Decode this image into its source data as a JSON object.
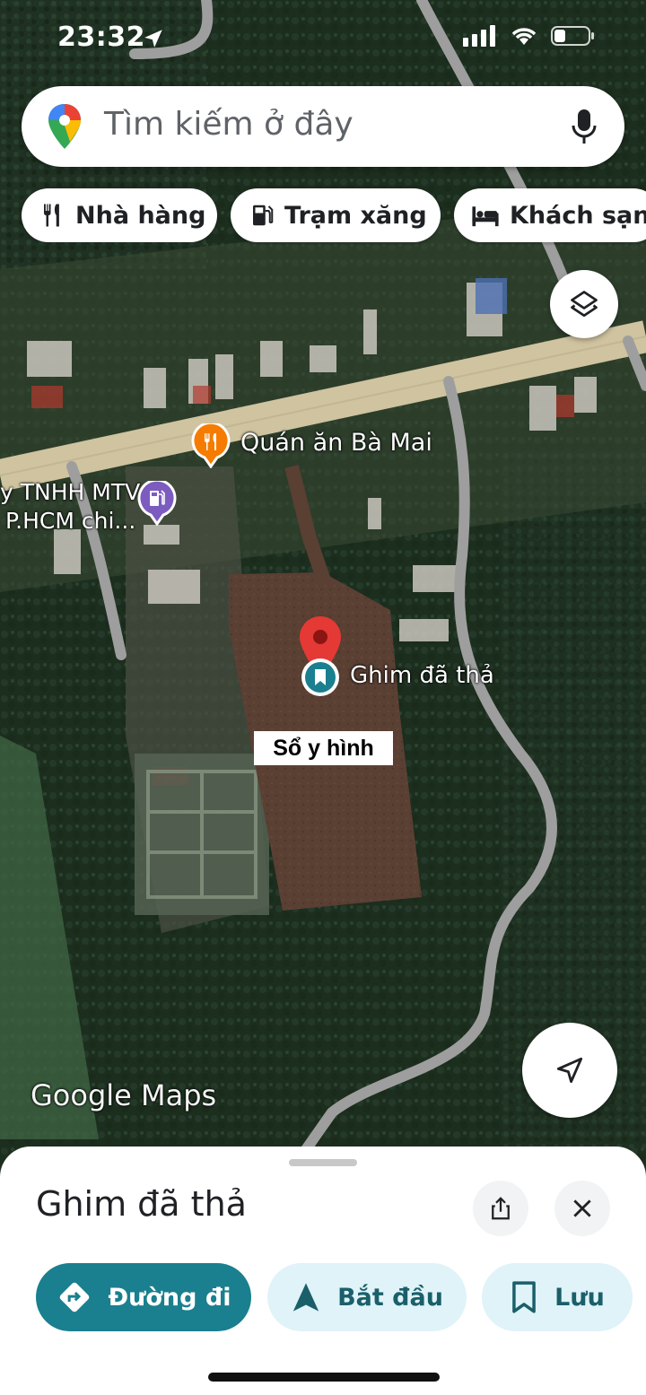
{
  "status_bar": {
    "time": "23:32"
  },
  "search": {
    "placeholder": "Tìm kiếm ở đây"
  },
  "chips": [
    {
      "label": "Nhà hàng",
      "icon": "restaurant-icon"
    },
    {
      "label": "Trạm xăng",
      "icon": "gas-station-icon"
    },
    {
      "label": "Khách sạn",
      "icon": "hotel-icon"
    }
  ],
  "map": {
    "poi_restaurant": "Quán ăn Bà Mai",
    "poi_gas_line1": "y TNHH MTV",
    "poi_gas_line2": "P.HCM chi...",
    "pin_label": "Ghim đã thả",
    "overlay_label": "Sổ y hình",
    "watermark": "Google Maps"
  },
  "sheet": {
    "title": "Ghim đã thả",
    "actions": {
      "directions": "Đường đi",
      "start": "Bắt đầu",
      "save": "Lưu"
    }
  },
  "colors": {
    "accent": "#1a7f8e",
    "accent_light": "#dff3f8",
    "pin": "#e53935",
    "poi_orange": "#f57c00",
    "poi_purple": "#7c5cbf"
  }
}
